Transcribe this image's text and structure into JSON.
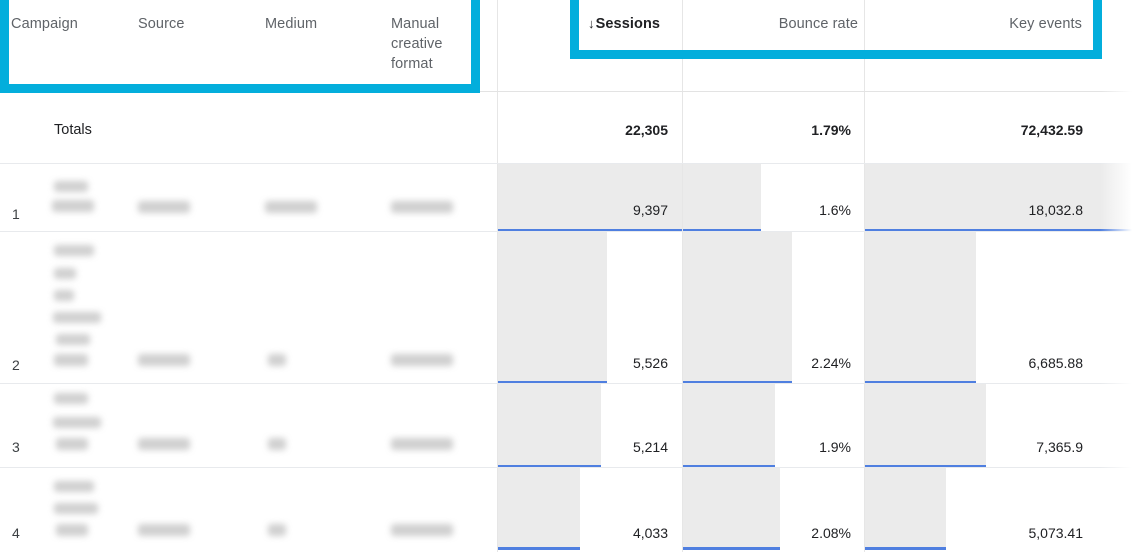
{
  "table": {
    "columns": [
      {
        "key": "campaign",
        "label": "Campaign",
        "align": "left"
      },
      {
        "key": "source",
        "label": "Source",
        "align": "left"
      },
      {
        "key": "medium",
        "label": "Medium",
        "align": "left"
      },
      {
        "key": "manual_creative_format",
        "label": "Manual creative format",
        "align": "left"
      },
      {
        "key": "sessions",
        "label": "Sessions",
        "align": "left",
        "sorted": true,
        "sort_direction": "descending",
        "sort_icon": "arrow-down-icon"
      },
      {
        "key": "bounce_rate",
        "label": "Bounce rate",
        "align": "right"
      },
      {
        "key": "key_events",
        "label": "Key events",
        "align": "right"
      }
    ],
    "header": {
      "campaign": "Campaign",
      "source": "Source",
      "medium": "Medium",
      "manual_creative_format": "Manual creative format",
      "sessions": "Sessions",
      "sessions_sort_arrow": "↓",
      "bounce_rate": "Bounce rate",
      "key_events": "Key events"
    },
    "totals": {
      "label": "Totals",
      "sessions": "22,305",
      "bounce_rate": "1.79%",
      "key_events": "72,432.59"
    },
    "rows": [
      {
        "index": "1",
        "campaign": "",
        "source": "",
        "medium": "",
        "manual_creative_format": "",
        "sessions": "9,397",
        "bounce_rate": "1.6%",
        "key_events": "18,032.8",
        "redacted": true
      },
      {
        "index": "2",
        "campaign": "",
        "source": "",
        "medium": "",
        "manual_creative_format": "",
        "sessions": "5,526",
        "bounce_rate": "2.24%",
        "key_events": "6,685.88",
        "redacted": true
      },
      {
        "index": "3",
        "campaign": "",
        "source": "",
        "medium": "",
        "manual_creative_format": "",
        "sessions": "5,214",
        "bounce_rate": "1.9%",
        "key_events": "7,365.9",
        "redacted": true
      },
      {
        "index": "4",
        "campaign": "",
        "source": "",
        "medium": "",
        "manual_creative_format": "",
        "sessions": "4,033",
        "bounce_rate": "2.08%",
        "key_events": "5,073.41",
        "redacted": true
      }
    ]
  },
  "annotations": {
    "color": "#03aedc",
    "boxes": [
      {
        "name": "dimension-columns-highlight",
        "target": "dimension column headers"
      },
      {
        "name": "metric-columns-highlight",
        "target": "metric column headers"
      }
    ]
  },
  "colors": {
    "accent_cyan": "#03aedc",
    "bar_fill": "#ebebeb",
    "bar_underline": "#4f7fe0",
    "text_primary": "#202124",
    "text_secondary": "#5f6368",
    "grid_line": "#e8eaed"
  },
  "chart_data": {
    "type": "table",
    "title": "Traffic acquisition table",
    "categories": [
      "1",
      "2",
      "3",
      "4"
    ],
    "series": [
      {
        "name": "Sessions",
        "values": [
          9397,
          5526,
          5214,
          4033
        ],
        "total": 22305
      },
      {
        "name": "Bounce rate",
        "values": [
          1.6,
          2.24,
          1.9,
          2.08
        ],
        "total": 1.79,
        "unit": "%"
      },
      {
        "name": "Key events",
        "values": [
          18032.8,
          6685.88,
          7365.9,
          5073.41
        ],
        "total": 72432.59
      }
    ]
  }
}
